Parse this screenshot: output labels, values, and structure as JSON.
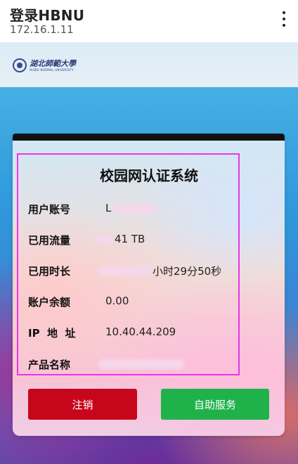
{
  "browser": {
    "title": "登录HBNU",
    "url": "172.16.1.11"
  },
  "header": {
    "logo_cn": "湖北師範大學",
    "logo_en": "HUBEI NORMAL UNIVERSITY"
  },
  "card": {
    "title": "校园网认证系统",
    "rows": [
      {
        "label": "用户账号",
        "value": "L"
      },
      {
        "label": "已用流量",
        "value": "41 TB"
      },
      {
        "label": "已用时长",
        "value": "小时29分50秒"
      },
      {
        "label": "账户余额",
        "value": "0.00"
      },
      {
        "label": "IP  地  址",
        "value": "10.40.44.209"
      },
      {
        "label": "产品名称",
        "value": ""
      }
    ],
    "buttons": {
      "logout": "注销",
      "service": "自助服务"
    }
  },
  "colors": {
    "logout": "#c8061b",
    "service": "#1fb24a",
    "highlight": "#e935e9"
  }
}
